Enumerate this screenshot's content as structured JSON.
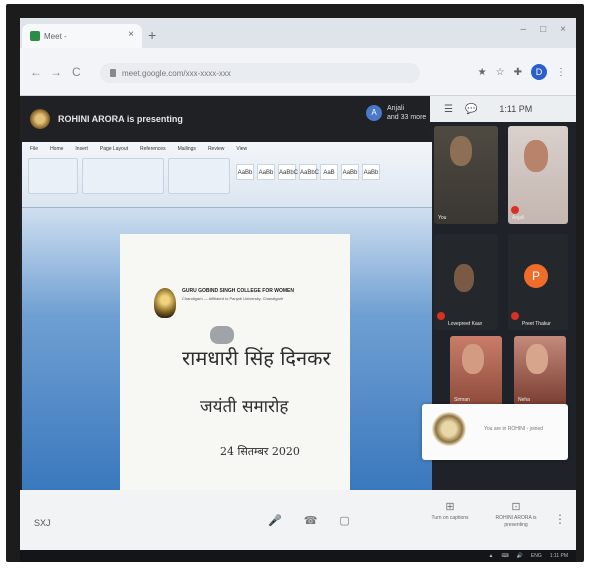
{
  "browser": {
    "tab_title": "Meet - ",
    "tab_close": "×",
    "new_tab": "+",
    "window_buttons": [
      "–",
      "□",
      "×"
    ],
    "nav": {
      "back": "←",
      "forward": "→",
      "reload": "C"
    },
    "url": "meet.google.com/xxx-xxxx-xxx",
    "extensions": [
      "★",
      "☆",
      "✚",
      "⋮"
    ],
    "profile_initial": "D"
  },
  "meet": {
    "presenting_label": "ROHINI ARORA is presenting",
    "pinned": {
      "initial": "A",
      "line1": "Anjali",
      "line2": "and 33 more"
    },
    "top_icons": [
      "☰",
      "💬"
    ],
    "clock": "1:11 PM",
    "document": {
      "menus": [
        "File",
        "Home",
        "Insert",
        "Page Layout",
        "References",
        "Mailings",
        "Review",
        "View"
      ],
      "styles": [
        "AaBb",
        "AaBb",
        "AaBbC",
        "AaBbC",
        "AaB",
        "AaBb",
        "AaBb"
      ],
      "college_name": "GURU GOBIND SINGH COLLEGE FOR WOMEN",
      "college_sub": "Chandigarh — Affiliated to Panjab University, Chandigarh",
      "hindi_title": "रामधारी सिंह दिनकर",
      "hindi_subtitle": "जयंती समारोह",
      "hindi_date": "24 सितम्बर 2020"
    },
    "participants": [
      {
        "label": "You"
      },
      {
        "label": "Anjali"
      },
      {
        "label": "Lovepreet Kaur"
      },
      {
        "label": "Preet Thakur",
        "initial": "P"
      },
      {
        "label": "Simran"
      },
      {
        "label": "Neha"
      }
    ],
    "notice_text": "You are in ROHINI - joined",
    "bottom": {
      "meeting_code": "SXJ",
      "controls": [
        "🎤",
        "☎",
        "▢"
      ],
      "present_now": {
        "icon": "⊞",
        "label": "Turn on captions"
      },
      "presenting": {
        "icon": "⊡",
        "label": "ROHINI ARORA is presenting"
      },
      "more": "⋮"
    }
  },
  "taskbar": [
    "▲",
    "⌨",
    "🔊",
    "ENG",
    "1:11 PM"
  ]
}
